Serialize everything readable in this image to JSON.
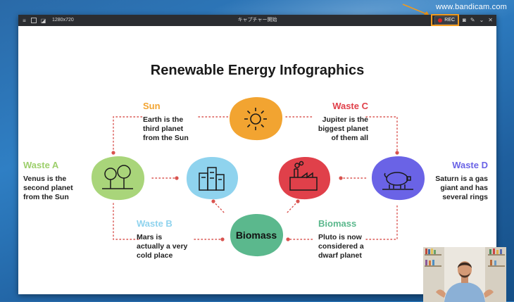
{
  "watermark": "www.bandicam.com",
  "titlebar": {
    "resolution": "1280x720",
    "title": "キャプチャー開始",
    "rec_label": "REC"
  },
  "slide": {
    "title": "Renewable Energy Infographics",
    "center_label": "Biomass",
    "items": {
      "sun": {
        "heading": "Sun",
        "lines": [
          "Earth is the",
          "third planet",
          "from the Sun"
        ],
        "color": "#f2a431"
      },
      "waste_c": {
        "heading": "Waste C",
        "lines": [
          "Jupiter is the",
          "biggest planet",
          "of them all"
        ],
        "color": "#e0404a"
      },
      "waste_a": {
        "heading": "Waste A",
        "lines": [
          "Venus is the",
          "second planet",
          "from the Sun"
        ],
        "color": "#9dcf6c"
      },
      "waste_d": {
        "heading": "Waste D",
        "lines": [
          "Saturn is a gas",
          "giant and has",
          "several rings"
        ],
        "color": "#6a63e6"
      },
      "waste_b": {
        "heading": "Waste B",
        "lines": [
          "Mars is",
          "actually a very",
          "cold place"
        ],
        "color": "#8fd3ee"
      },
      "biomass": {
        "heading": "Biomass",
        "lines": [
          "Pluto is now",
          "considered a",
          "dwarf planet"
        ],
        "color": "#5bb88d"
      }
    }
  },
  "colors": {
    "dots": "#d9534f",
    "rec_highlight": "#f29a1c"
  }
}
